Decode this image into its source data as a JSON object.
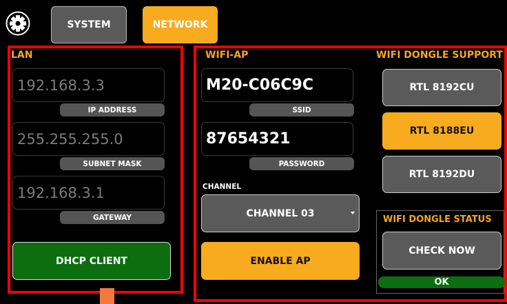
{
  "tabs": {
    "system": "SYSTEM",
    "network": "NETWORK"
  },
  "lan": {
    "title": "LAN",
    "ip_address": {
      "value": "192.168.3.3",
      "label": "IP ADDRESS"
    },
    "subnet_mask": {
      "value": "255.255.255.0",
      "label": "SUBNET MASK"
    },
    "gateway": {
      "value": "192.168.3.1",
      "label": "GATEWAY"
    },
    "dhcp_button": "DHCP CLIENT"
  },
  "wifi_ap": {
    "title": "WIFI-AP",
    "ssid": {
      "value": "M20-C06C9C",
      "label": "SSID"
    },
    "password": {
      "value": "87654321",
      "label": "PASSWORD"
    },
    "channel_label": "CHANNEL",
    "channel_selected": "CHANNEL 03",
    "enable_button": "ENABLE AP"
  },
  "dongle_support": {
    "title": "WIFI DONGLE SUPPORT",
    "options": [
      "RTL 8192CU",
      "RTL 8188EU",
      "RTL 8192DU"
    ],
    "selected": "RTL 8188EU"
  },
  "dongle_status": {
    "title": "WIFI DONGLE STATUS",
    "check_button": "CHECK NOW",
    "status": "OK"
  },
  "colors": {
    "accent_orange": "#f8ab1f",
    "panel_border_red": "#ff0000",
    "button_gray": "#5a5a5a",
    "button_green": "#0c6e0f"
  },
  "icons": {
    "settings": "gear-icon",
    "dropdown": "caret-down-icon"
  }
}
